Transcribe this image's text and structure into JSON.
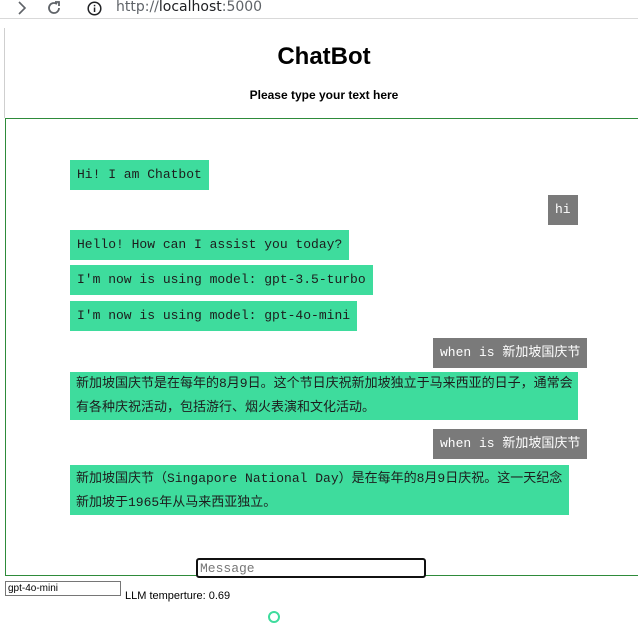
{
  "browser": {
    "url_scheme": "http://",
    "url_host": "localhost",
    "url_port": ":5000",
    "icons": [
      "forward-icon",
      "reload-icon",
      "info-icon"
    ]
  },
  "header": {
    "title": "ChatBot",
    "subtitle": "Please type your text here"
  },
  "messages": [
    {
      "role": "bot",
      "text": "Hi! I am Chatbot"
    },
    {
      "role": "user",
      "text": "hi"
    },
    {
      "role": "bot",
      "text": "Hello! How can I assist you today?"
    },
    {
      "role": "bot",
      "text": "I'm now is using model: gpt-3.5-turbo"
    },
    {
      "role": "bot",
      "text": "I'm now is using model: gpt-4o-mini"
    },
    {
      "role": "user",
      "text": "when is 新加坡国庆节"
    },
    {
      "role": "bot",
      "text": "新加坡国庆节是在每年的8月9日。这个节日庆祝新加坡独立于马来西亚的日子，通常会有各种庆祝活动，包括游行、烟火表演和文化活动。"
    },
    {
      "role": "user",
      "text": "when is 新加坡国庆节"
    },
    {
      "role": "bot",
      "text": "新加坡国庆节（Singapore National Day）是在每年的8月9日庆祝。这一天纪念新加坡于1965年从马来西亚独立。"
    }
  ],
  "input": {
    "placeholder": "Message",
    "value": ""
  },
  "controls": {
    "model_selected": "gpt-4o-mini",
    "temperature_label": "LLM temperture: 0.69"
  },
  "colors": {
    "bot_bubble": "#3edc9d",
    "user_bubble": "#7a7a7a",
    "chat_border": "#2e8b3a"
  }
}
